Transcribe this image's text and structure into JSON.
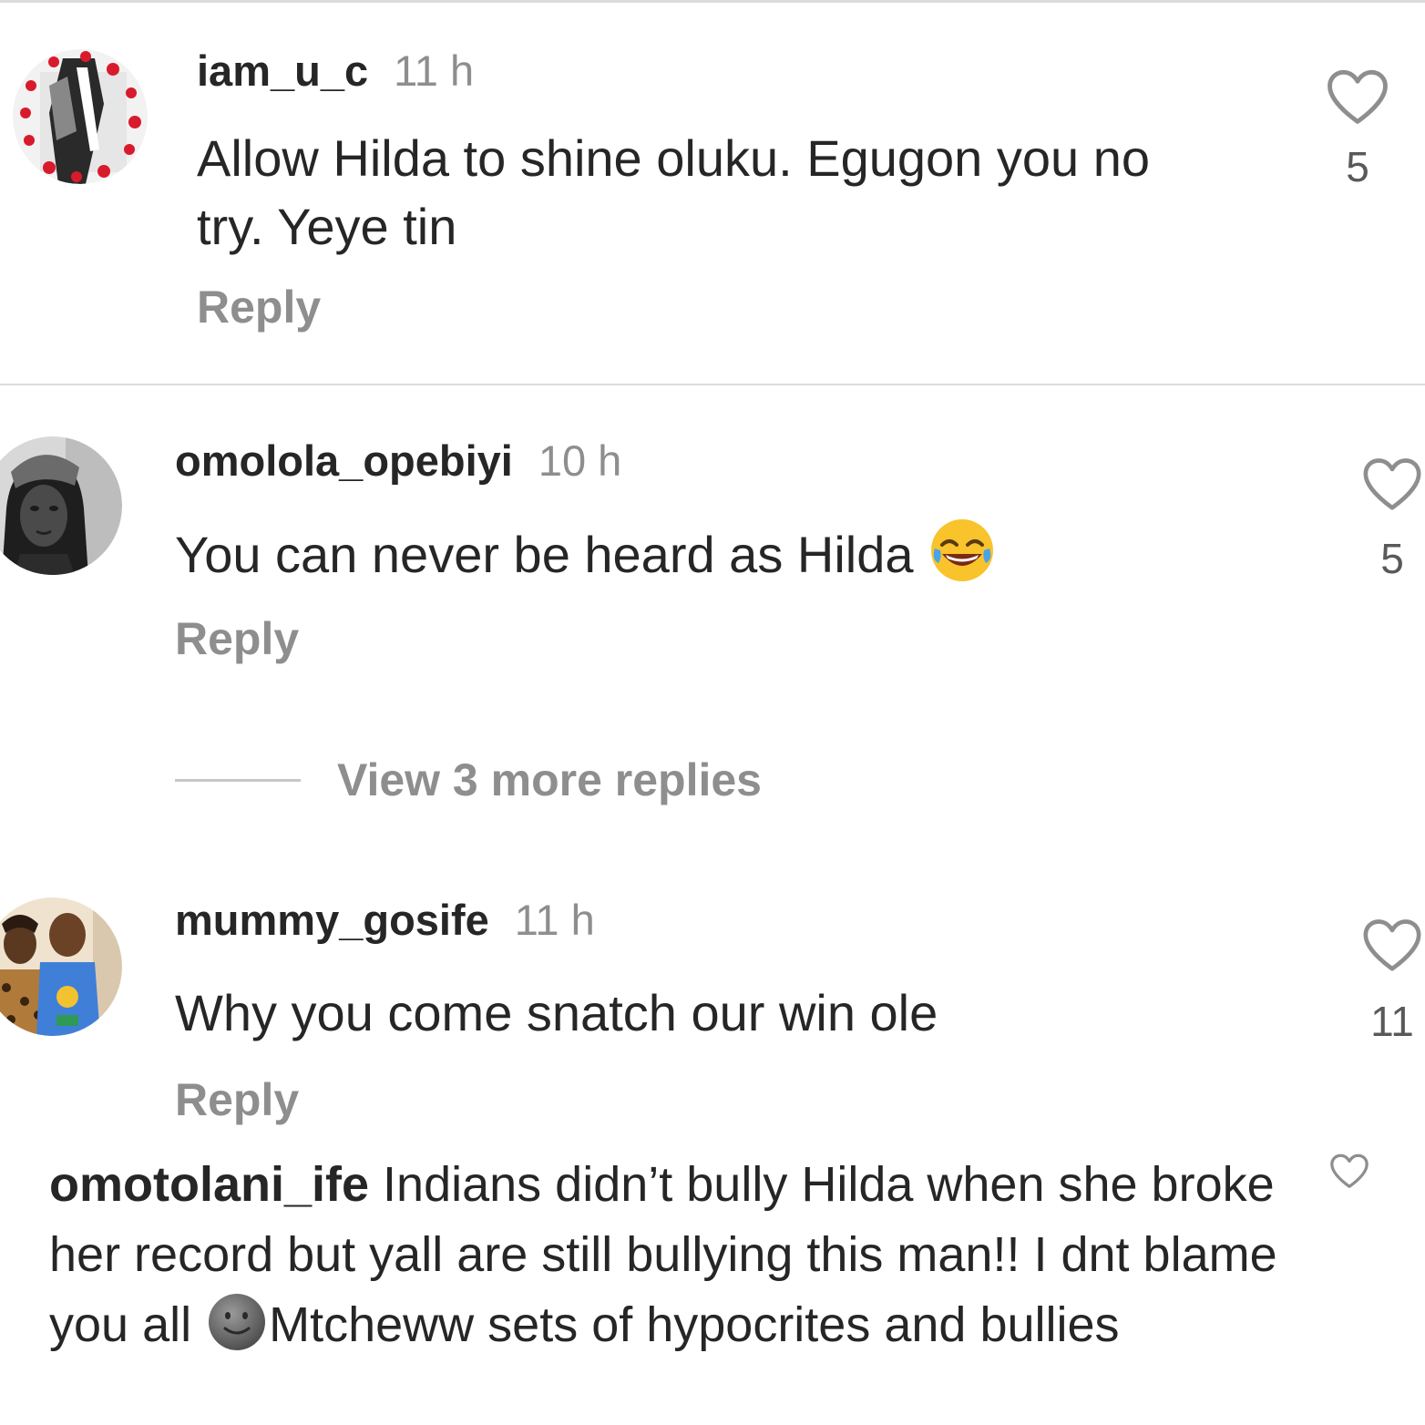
{
  "comments": [
    {
      "username": "iam_u_c",
      "time": "11 h",
      "text_line1": "Allow Hilda to shine oluku. Egugon you no",
      "text_line2": "try. Yeye tin",
      "reply_label": "Reply",
      "likes": "5"
    },
    {
      "username": "omolola_opebiyi",
      "time": "10 h",
      "text": "You can never be heard as Hilda",
      "emoji": "face-with-tears-of-joy",
      "reply_label": "Reply",
      "likes": "5"
    },
    {
      "username": "mummy_gosife",
      "time": "11 h",
      "text": "Why you come snatch our win ole",
      "reply_label": "Reply",
      "likes": "11"
    }
  ],
  "view_more_replies": "View 3 more replies",
  "legacy_comment": {
    "username": "omotolani_ife",
    "text_part1": "Indians didn’t bully Hilda when she broke her record but yall are still bullying this man!! I dnt blame you all",
    "emoji": "new-moon-face",
    "text_part2": "Mtcheww sets of hypocrites and bullies"
  },
  "colors": {
    "primary_text": "#262626",
    "secondary_text": "#8e8e8e",
    "divider": "#dbdbdb"
  },
  "icons": [
    "heart-outline-icon",
    "face-with-tears-of-joy-emoji",
    "new-moon-face-emoji"
  ]
}
